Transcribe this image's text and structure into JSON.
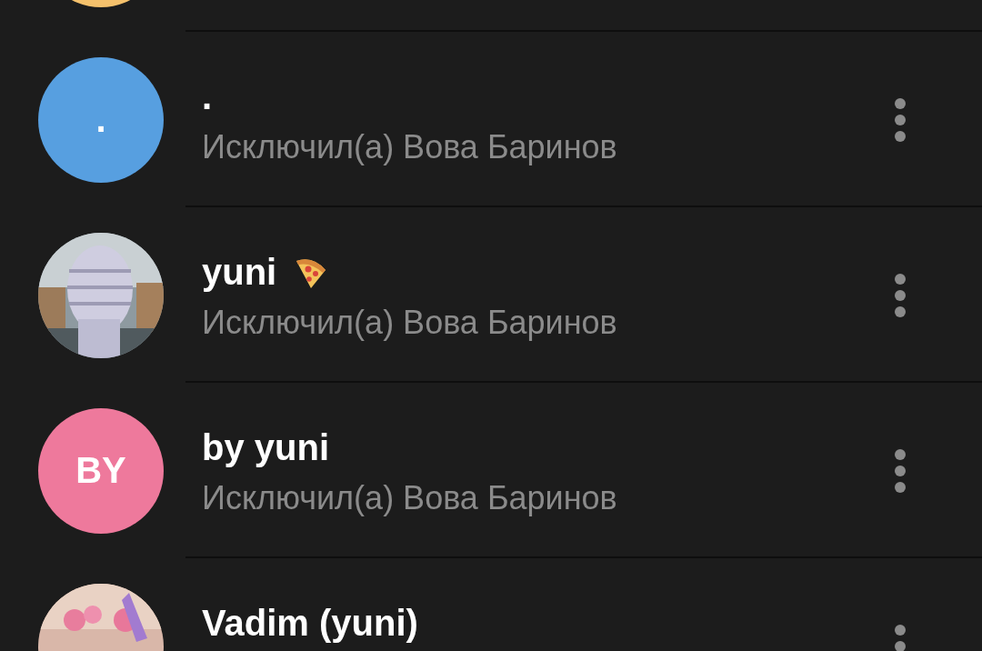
{
  "members": [
    {
      "avatar": {
        "kind": "initials",
        "color": "#f5c16c"
      }
    },
    {
      "avatar": {
        "kind": "initials",
        "color": "#579fe0",
        "initials": "."
      },
      "name": ".",
      "subtitle": "Исключил(а) Вова Баринов"
    },
    {
      "name": "yuni",
      "emoji": true,
      "subtitle": "Исключил(а) Вова Баринов"
    },
    {
      "avatar": {
        "kind": "initials",
        "color": "#ee799c",
        "initials": "BY"
      },
      "name": "by yuni",
      "subtitle": "Исключил(а) Вова Баринов"
    },
    {
      "name": "Vadim (yuni)"
    }
  ]
}
